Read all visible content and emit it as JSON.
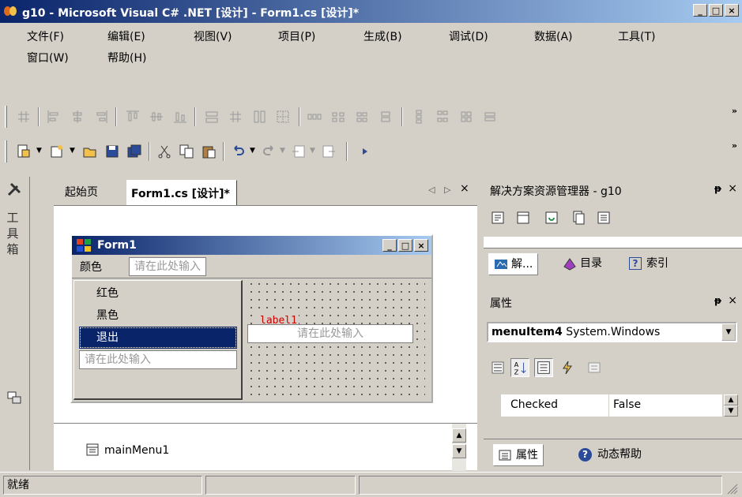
{
  "window": {
    "title": "g10 - Microsoft Visual C# .NET [设计] - Form1.cs [设计]*",
    "controls": {
      "minimize": "_",
      "maximize": "□",
      "close": "×"
    }
  },
  "menu": {
    "items": [
      "文件(F)",
      "编辑(E)",
      "视图(V)",
      "项目(P)",
      "生成(B)",
      "调试(D)",
      "数据(A)",
      "工具(T)",
      "窗口(W)",
      "帮助(H)"
    ]
  },
  "toolbar": {
    "overflow": "»"
  },
  "toolbox": {
    "label": "工具箱"
  },
  "doc_tabs": {
    "start_page": "起始页",
    "active": "Form1.cs [设计]*",
    "nav_left": "◁",
    "nav_right": "▷",
    "close": "×"
  },
  "form1": {
    "title": "Form1",
    "menu_label": "颜色",
    "type_here": "请在此处输入",
    "dropdown_items": [
      "红色",
      "黑色",
      "退出"
    ],
    "dropdown_selected": "退出",
    "side_type_here": "请在此处输入",
    "bottom_type_here": "请在此处输入",
    "label1": "label1"
  },
  "tray": {
    "component": "mainMenu1"
  },
  "solution_explorer": {
    "title": "解决方案资源管理器 - g10",
    "pin": "ᵽ",
    "close": "×",
    "tabs": [
      "解...",
      "目录",
      "索引"
    ]
  },
  "properties": {
    "title": "属性",
    "pin": "ᵽ",
    "close": "×",
    "selected_object_name": "menuItem4",
    "selected_object_type": "System.Windows",
    "row": {
      "name": "Checked",
      "value": "False"
    },
    "tabs": [
      "属性",
      "动态帮助"
    ]
  },
  "status": {
    "text": "就绪"
  },
  "colors": {
    "titlebar_start": "#0a246a",
    "titlebar_end": "#a6caf0",
    "face": "#d4d0c8",
    "selection": "#0a246a",
    "label_text": "#cc0000"
  }
}
